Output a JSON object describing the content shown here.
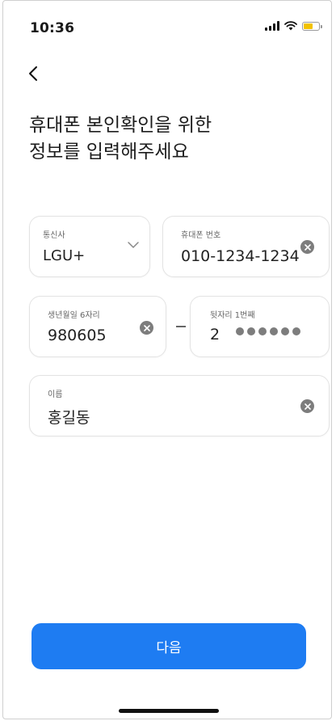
{
  "status": {
    "time": "10:36",
    "battery_color": "#f2c200"
  },
  "page": {
    "title_line1": "휴대폰 본인확인을 위한",
    "title_line2": "정보를 입력해주세요"
  },
  "form": {
    "carrier": {
      "label": "통신사",
      "value": "LGU+"
    },
    "phone": {
      "label": "휴대폰 번호",
      "value": "010-1234-1234"
    },
    "birth": {
      "label": "생년월일 6자리",
      "value": "980605"
    },
    "rrn_digit": {
      "label": "뒷자리 1번째",
      "value": "2"
    },
    "name": {
      "label": "이름",
      "value": "홍길동"
    }
  },
  "actions": {
    "next_label": "다음",
    "accent_color": "#1e7cf2"
  }
}
